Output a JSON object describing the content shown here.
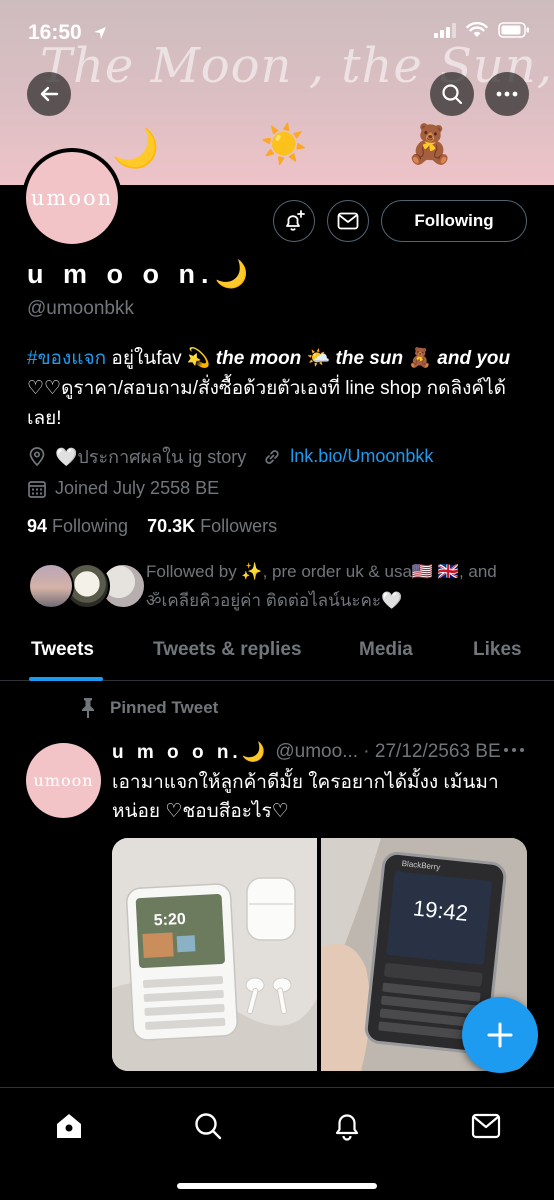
{
  "status_bar": {
    "time": "16:50"
  },
  "banner": {
    "script_text": "The Moon , the Sun, And You",
    "emojis": [
      "🌙",
      "☀️",
      "🧸"
    ]
  },
  "header": {
    "avatar_text": "umoon",
    "follow_label": "Following",
    "display_name": "u m o o n.🌙",
    "handle": "@umoonbkk"
  },
  "bio": {
    "hashtag": "#ของแจก",
    "part1": " อยู่ในfav 💫 ",
    "em1": "the moon",
    "part2": " 🌤️ ",
    "em2": "the sun",
    "part3": " 🧸 ",
    "em3": "and you",
    "line2": "♡♡ดูราคา/สอบถาม/สั่งซื้อด้วยตัวเองที่ line shop กดลิงค์ได้เลย!"
  },
  "meta": {
    "location": "🤍ประกาศผลใน ig story",
    "link": "lnk.bio/Umoonbkk",
    "joined": "Joined July 2558 BE"
  },
  "counts": {
    "following_num": "94",
    "following_label": " Following",
    "followers_num": "70.3K",
    "followers_label": " Followers"
  },
  "followed_by": "Followed by ✨, pre order uk & usa🇺🇸 🇬🇧, and ॐเคลียคิวอยู่ค่า ติดต่อไลน์นะคะ🤍",
  "tabs": [
    "Tweets",
    "Tweets & replies",
    "Media",
    "Likes"
  ],
  "tweet": {
    "pinned_label": "Pinned Tweet",
    "avatar_text": "umoon",
    "name": "u m o o n.🌙",
    "handle": "@umoo... · 27/12/2563 BE",
    "text": "เอามาแจกให้ลูกค้าดีมั้ย ใครอยากได้มั้งง เม้นมาหน่อย ♡ชอบสีอะไร♡",
    "media_left_clock": "5:20",
    "media_right_clock": "19:42",
    "media_brand": "BlackBerry"
  },
  "colors": {
    "accent": "#1d9bf0",
    "avatar_pink": "#f2c4c8",
    "muted": "#71767b"
  }
}
